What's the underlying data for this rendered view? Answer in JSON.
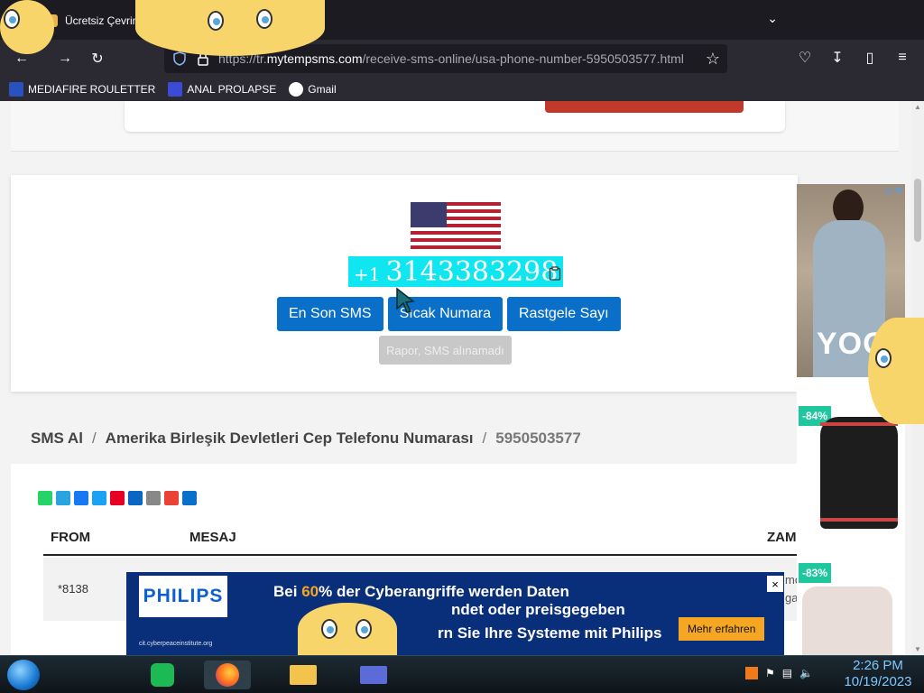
{
  "browser": {
    "tab_title": "Ücretsiz Çevrim",
    "url_proto": "https://tr.",
    "url_domain": "mytempsms.com",
    "url_path": "/receive-sms-online/usa-phone-number-5950503577.html",
    "bookmarks": [
      {
        "label": "MEDIAFIRE ROULETTER"
      },
      {
        "label": "ANAL PROLAPSE"
      },
      {
        "label": "Gmail"
      }
    ]
  },
  "number_card": {
    "country_code": "+1",
    "number": "3143383298",
    "buttons": [
      "En Son SMS",
      "Sıcak Numara",
      "Rastgele Sayı"
    ],
    "report_label": "Rapor, SMS alınamadı"
  },
  "breadcrumb": {
    "root": "SMS Al",
    "country": "Amerika Birleşik Devletleri Cep Telefonu Numarası",
    "current": "5950503577",
    "separator": "/"
  },
  "messages": {
    "columns": [
      "FROM",
      "MESAJ",
      "ZAM"
    ],
    "rows": [
      {
        "from": "*8138",
        "time": "mo\nga"
      }
    ]
  },
  "ads": {
    "right": {
      "brand": "YOOX",
      "discounts": [
        "-84%",
        "-83%"
      ]
    },
    "bottom": {
      "logo": "PHILIPS",
      "line1_pre": "Bei ",
      "line1_pct": "60",
      "line1_post": "% der Cyberangriffe werden Daten",
      "line2": "ndet oder preisgegeben",
      "line3": "rn Sie Ihre Systeme mit Philips",
      "source": "cit.cyberpeaceinstitute.org",
      "cta": "Mehr erfahren",
      "close": "×"
    }
  },
  "taskbar": {
    "time": "2:26 PM",
    "date": "10/19/2023"
  },
  "colors": {
    "primary_button": "#0a6fc9",
    "highlight": "#0fe6f0",
    "ad_navy": "#0a2f7a",
    "ad_cta": "#f5a623",
    "discount_badge": "#1fc79f"
  }
}
